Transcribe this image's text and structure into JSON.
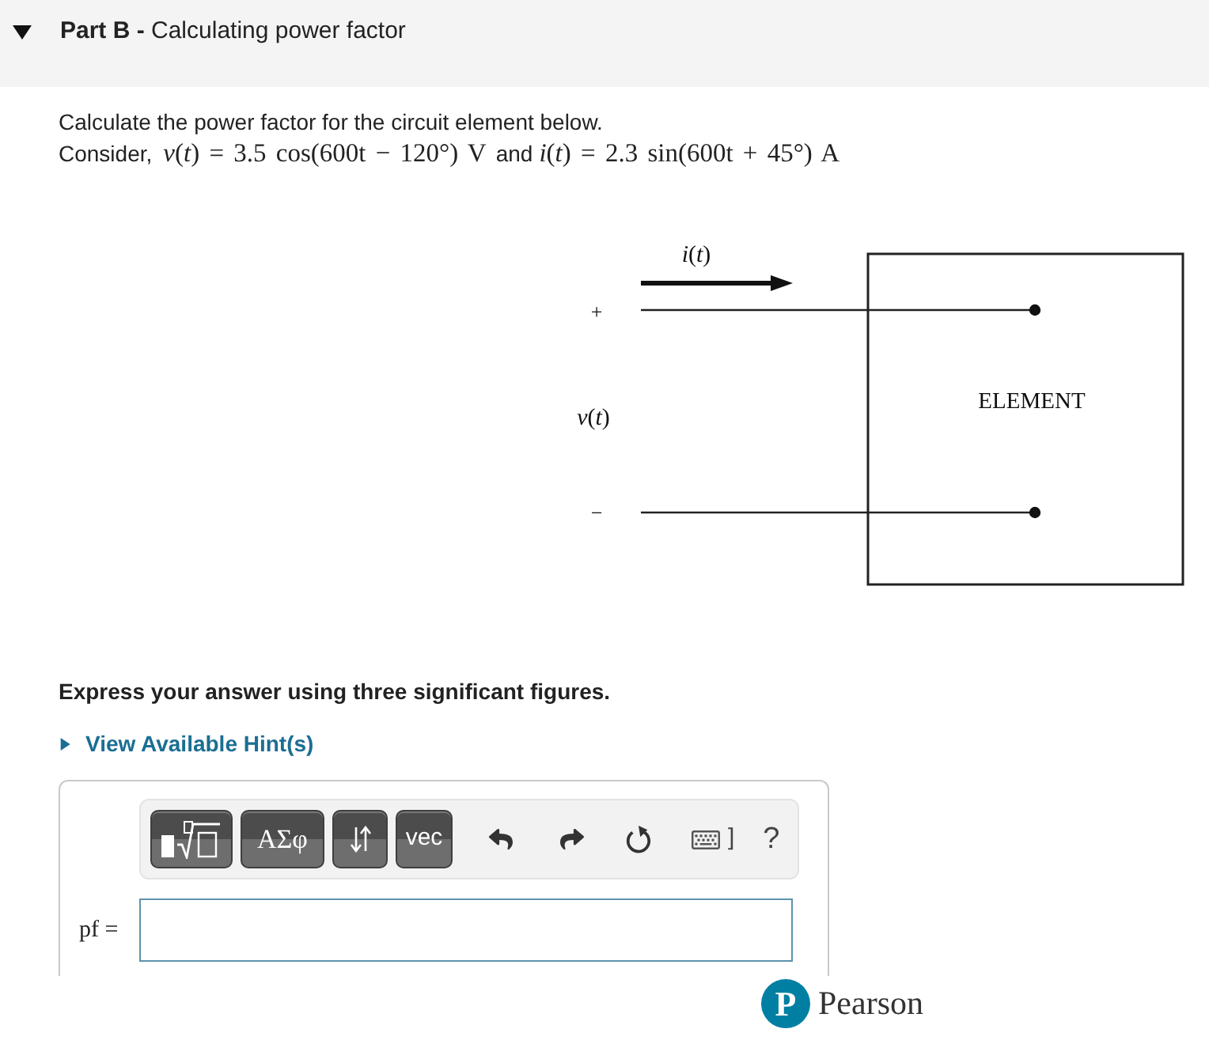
{
  "part": {
    "expanded": true,
    "title": "**Part B -** Calculating power factor"
  },
  "question": {
    "prompt": "Calculate the power factor for the circuit element below.",
    "intro": "Consider,",
    "voltage": "*v*(*t*) = 3.5 cos(600t − 120°) V",
    "joiner": "and",
    "current": "*i*(*t*) = 2.3 sin(600t + 45°) A"
  },
  "circuit": {
    "current_label": "*i*(*t*)",
    "positive_terminal": "+",
    "voltage_label": "*v*(*t*)",
    "negative_terminal": "−",
    "element_label": "ELEMENT"
  },
  "instruction": "Express your answer using three significant figures.",
  "hint": {
    "label": "View Available Hint(s)",
    "expanded": false
  },
  "toolbar": [
    {
      "kind": "templates"
    },
    {
      "kind": "symbols",
      "label": "ΑΣφ"
    },
    {
      "kind": "arrows"
    },
    {
      "kind": "vector",
      "label": "vec"
    },
    {
      "kind": "undo"
    },
    {
      "kind": "redo"
    },
    {
      "kind": "reset"
    },
    {
      "kind": "keyboard",
      "label": "]"
    },
    {
      "kind": "help",
      "label": "?"
    }
  ],
  "answer": {
    "label": "pf ="
  },
  "footer": {
    "logo_mark": "P",
    "brand": "Pearson"
  }
}
